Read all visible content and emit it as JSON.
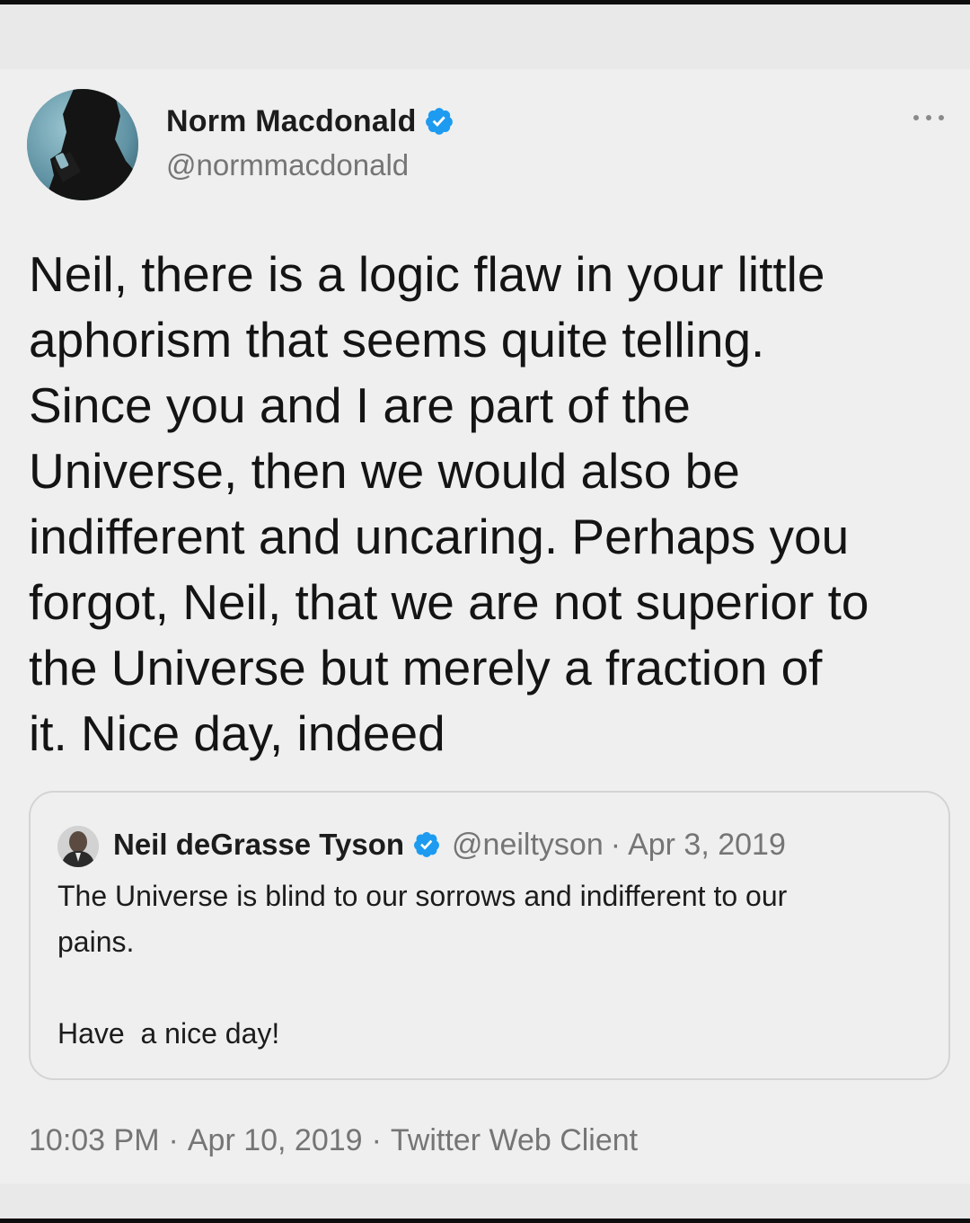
{
  "tweet": {
    "author": {
      "display_name": "Norm Macdonald",
      "handle": "@normmacdonald",
      "verified": true
    },
    "text": "Neil, there is a logic flaw in your little\naphorism that seems quite telling.\nSince you and I are part of the\nUniverse, then we would also be\nindifferent and uncaring. Perhaps you\nforgot, Neil, that we are not superior to\nthe Universe but merely a fraction of\nit. Nice day, indeed",
    "quoted": {
      "display_name": "Neil deGrasse Tyson",
      "handle": "@neiltyson",
      "separator": "·",
      "date": "Apr 3, 2019",
      "verified": true,
      "text": "The Universe is blind to our sorrows and indifferent to our\npains.\n\nHave  a nice day!"
    },
    "meta": {
      "time": "10:03 PM",
      "separator": "·",
      "date": "Apr 10, 2019",
      "client": "Twitter Web Client"
    }
  },
  "icons": {
    "verified": "verified-badge-icon",
    "more": "more-options-icon"
  },
  "colors": {
    "verified_blue": "#1d9bf0",
    "muted_text": "#757575",
    "primary_text": "#141414",
    "card_bg": "#efefef"
  }
}
